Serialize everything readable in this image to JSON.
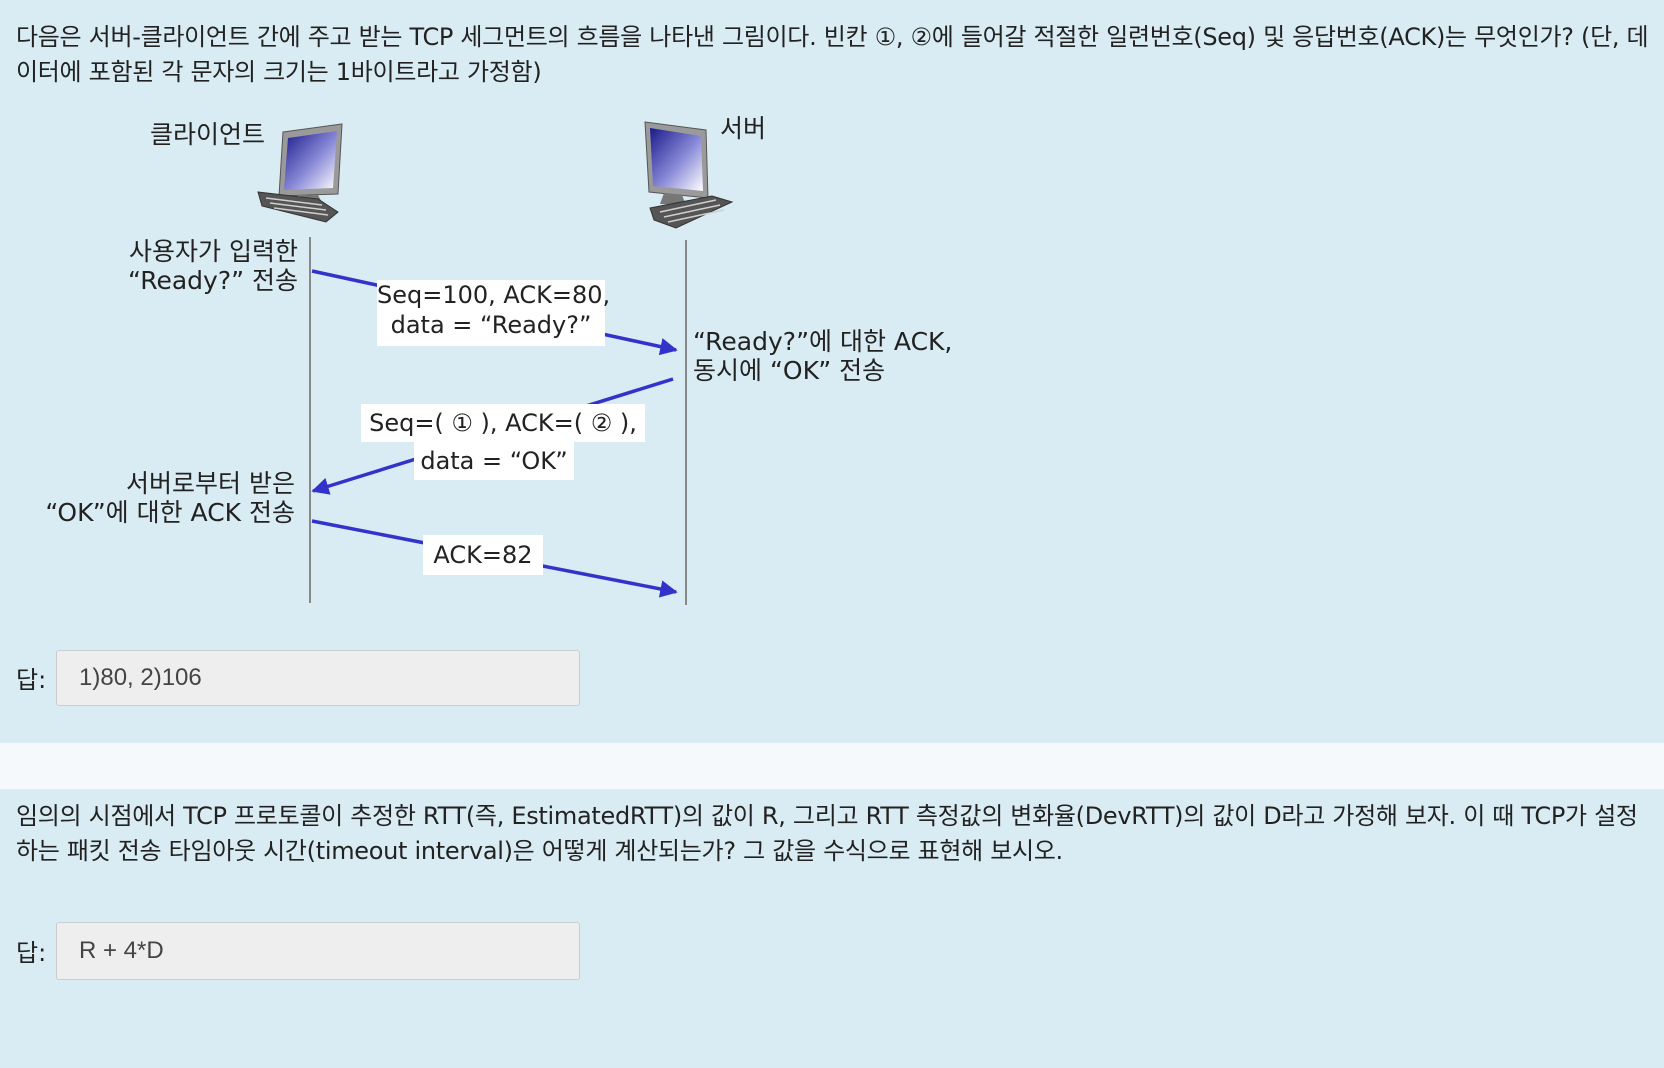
{
  "question1": {
    "text": "다음은 서버-클라이언트 간에 주고 받는 TCP 세그먼트의 흐름을 나타낸 그림이다. 빈칸 ①, ②에 들어갈 적절한 일련번호(Seq) 및 응답번호(ACK)는 무엇인가? (단, 데이터에 포함된 각 문자의 크기는 1바이트라고 가정함)",
    "diagram": {
      "client_label": "클라이언트",
      "server_label": "서버",
      "step1_line1": "사용자가 입력한",
      "step1_line2": "“Ready?” 전송",
      "seg1_line1": "Seq=100, ACK=80,",
      "seg1_line2": "data = “Ready?”",
      "step2_line1": "“Ready?”에 대한 ACK,",
      "step2_line2": "동시에 “OK” 전송",
      "seg2_line1": "Seq=( ① ), ACK=( ② ),",
      "seg2_line2": "data = “OK”",
      "step3_line1": "서버로부터 받은",
      "step3_line2": "“OK”에 대한 ACK 전송",
      "seg3_label": "ACK=82",
      "arrow_color": "#3333cc",
      "timeline_color": "#888888"
    },
    "answer_label": "답:",
    "answer_value": "1)80, 2)106"
  },
  "question2": {
    "text": "임의의 시점에서 TCP 프로토콜이 추정한 RTT(즉, EstimatedRTT)의 값이 R, 그리고 RTT 측정값의 변화율(DevRTT)의 값이 D라고 가정해 보자. 이 때 TCP가 설정하는 패킷 전송 타임아웃 시간(timeout interval)은 어떻게 계산되는가? 그 값을 수식으로 표현해 보시오.",
    "answer_label": "답:",
    "answer_value": "R + 4*D"
  }
}
